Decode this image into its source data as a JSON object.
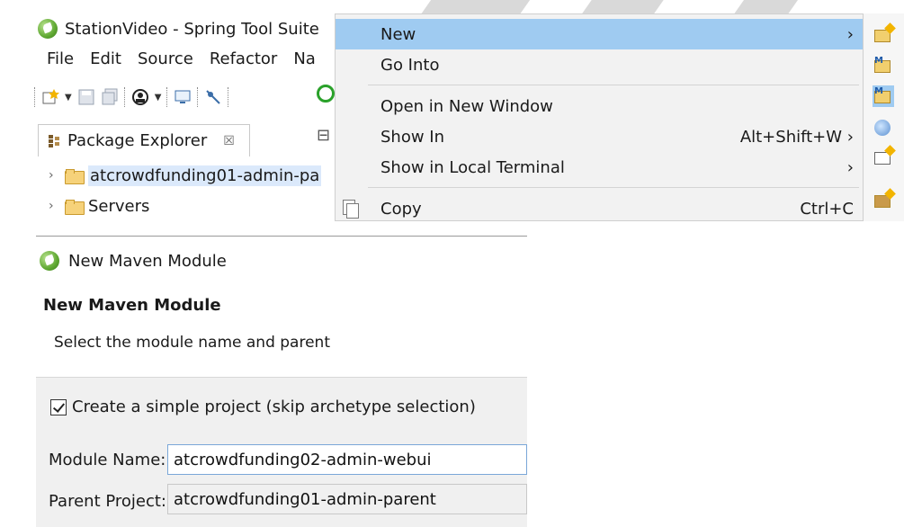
{
  "window": {
    "title": "StationVideo - Spring Tool Suite",
    "menu": [
      "File",
      "Edit",
      "Source",
      "Refactor",
      "Na"
    ]
  },
  "package_explorer": {
    "tab_label": "Package Explorer",
    "close_glyph": "☒",
    "tree": [
      {
        "label": "atcrowdfunding01-admin-pa",
        "selected": true,
        "icon": "maven-project-icon"
      },
      {
        "label": "Servers",
        "selected": false,
        "icon": "folder-icon"
      }
    ]
  },
  "context_menu": {
    "items": [
      {
        "label": "New",
        "accel": "",
        "submenu": true,
        "highlighted": true
      },
      {
        "label": "Go Into",
        "accel": "",
        "submenu": false
      },
      {
        "label": "Open in New Window",
        "accel": "",
        "submenu": false
      },
      {
        "label": "Show In",
        "accel": "Alt+Shift+W",
        "submenu": true
      },
      {
        "label": "Show in Local Terminal",
        "accel": "",
        "submenu": true
      },
      {
        "label": "Copy",
        "accel": "Ctrl+C",
        "submenu": false
      }
    ],
    "submenu_arrow": "›"
  },
  "dialog": {
    "window_title": "New Maven Module",
    "heading": "New Maven Module",
    "description": "Select the module name and parent",
    "simple_project_label": "Create a simple project (skip archetype selection)",
    "simple_project_checked": true,
    "module_name_label": "Module Name:",
    "module_name_value": "atcrowdfunding02-admin-webui",
    "parent_project_label": "Parent Project:",
    "parent_project_value": "atcrowdfunding01-admin-parent"
  },
  "colors": {
    "menu_highlight": "#9fcbf1",
    "selection": "#dbe9fb",
    "spring_green": "#5fa832"
  }
}
